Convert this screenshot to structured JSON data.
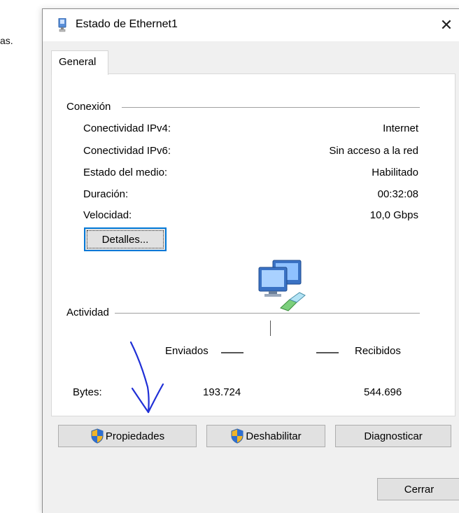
{
  "background": {
    "fragment": "as."
  },
  "window": {
    "title": "Estado de Ethernet1",
    "close_icon": "✕",
    "tab_label": "General"
  },
  "connection": {
    "group_label": "Conexión",
    "rows": [
      {
        "label": "Conectividad IPv4:",
        "value": "Internet"
      },
      {
        "label": "Conectividad IPv6:",
        "value": "Sin acceso a la red"
      },
      {
        "label": "Estado del medio:",
        "value": "Habilitado"
      },
      {
        "label": "Duración:",
        "value": "00:32:08"
      },
      {
        "label": "Velocidad:",
        "value": "10,0 Gbps"
      }
    ],
    "details_button": "Detalles..."
  },
  "activity": {
    "group_label": "Actividad",
    "sent_label": "Enviados",
    "received_label": "Recibidos",
    "bytes_label": "Bytes:",
    "bytes_sent": "193.724",
    "bytes_received": "544.696"
  },
  "buttons": {
    "properties": "Propiedades",
    "disable": "Deshabilitar",
    "diagnose": "Diagnosticar",
    "close": "Cerrar"
  },
  "icons": {
    "title": "network-adapter-icon",
    "activity": "network-computers-icon",
    "uac": "uac-shield-icon"
  },
  "colors": {
    "focus_border": "#0078d7",
    "annotation_ink": "#1f2fd6"
  }
}
